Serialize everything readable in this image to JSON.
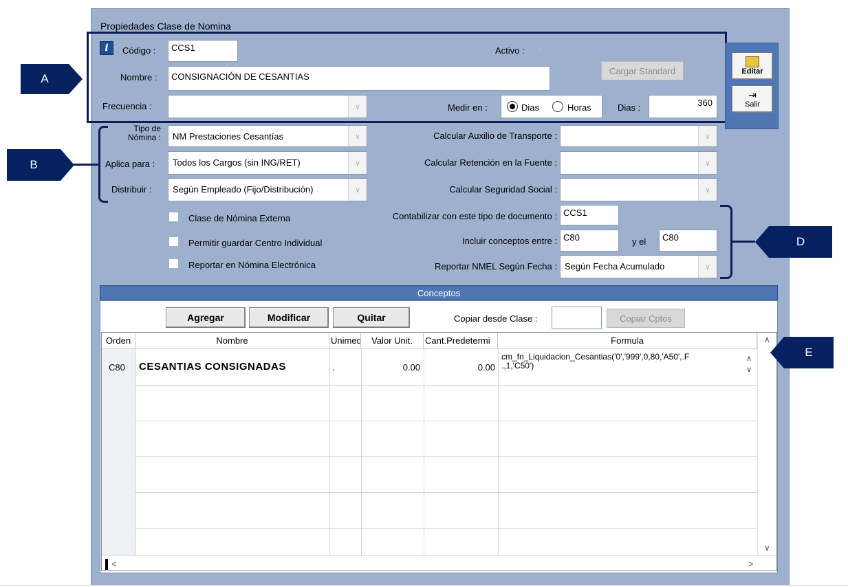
{
  "window": {
    "title": "Propiedades Clase de Nomina"
  },
  "markers": {
    "a": "A",
    "b": "B",
    "d": "D",
    "e": "E"
  },
  "section_a": {
    "codigo_label": "Código :",
    "codigo_value": "CCS1",
    "activo_label": "Activo :",
    "activo_checked": true,
    "nombre_label": "Nombre :",
    "nombre_value": "CONSIGNACIÓN DE CESANTIAS",
    "cargar_standard": "Cargar Standard",
    "frecuencia_label": "Frecuencia :",
    "frecuencia_value": "",
    "medir_label": "Medir en :",
    "medir_options": [
      "Dias",
      "Horas"
    ],
    "medir_selected": "Dias",
    "dias_label": "Dias :",
    "dias_value": "360"
  },
  "side_buttons": {
    "editar": "Editar",
    "salir": "Salir"
  },
  "section_b": {
    "tipo_label_1": "Tipo de",
    "tipo_label_2": "Nómina :",
    "tipo_value": "NM Prestaciones Cesantías",
    "aplica_label": "Aplica para :",
    "aplica_value": "Todos los Cargos (sin ING/RET)",
    "distribuir_label": "Distribuir :",
    "distribuir_value": "Según Empleado (Fijo/Distribución)"
  },
  "calc": {
    "auxilio_label": "Calcular Auxilio de Transporte :",
    "auxilio_value": "",
    "retencion_label": "Calcular Retención en la Fuente :",
    "retencion_value": "",
    "seguridad_label": "Calcular Seguridad Social :",
    "seguridad_value": ""
  },
  "checks": {
    "externa": "Clase de Nómina Externa",
    "centro": "Permitir guardar Centro Individual",
    "electronica": "Reportar en Nómina Electrónica"
  },
  "section_d": {
    "contabilizar_label": "Contabilizar con este tipo de documento :",
    "contabilizar_value": "CCS1",
    "incluir_label": "Incluir conceptos entre :",
    "incluir_from": "C80",
    "y_el_label": "y el",
    "incluir_to": "C80",
    "reportar_label": "Reportar NMEL Según Fecha :",
    "reportar_value": "Según Fecha Acumulado"
  },
  "conceptos": {
    "header": "Conceptos",
    "agregar": "Agregar",
    "modificar": "Modificar",
    "quitar": "Quitar",
    "copiar_label": "Copiar desde Clase :",
    "copiar_value": "",
    "copiar_cptos": "Copiar Cptos",
    "columns": [
      "Orden",
      "Nombre",
      "Unimed",
      "Valor Unit.",
      "Cant.Predetermi",
      "Formula"
    ],
    "rows": [
      {
        "orden": "C80",
        "nombre": "CESANTIAS CONSIGNADAS",
        "unimed": ".",
        "valor": "0.00",
        "cant": "0.00",
        "formula_1": "cm_fn_Liquidacion_Cesantias('0','999',0,80,'A50',.F",
        "formula_2": ".,1,'C50')"
      }
    ]
  },
  "icons": {
    "info": "info-icon",
    "editar": "edit-icon",
    "salir": "exit-icon"
  }
}
